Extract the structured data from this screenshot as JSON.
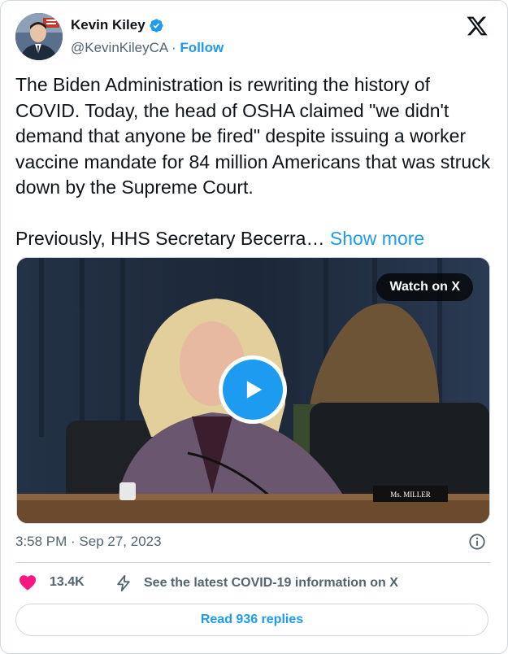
{
  "author": {
    "name": "Kevin Kiley",
    "handle": "@KevinKileyCA",
    "separator": " · ",
    "follow_label": "Follow",
    "verified_icon": "verified-badge-icon"
  },
  "tweet": {
    "text": "The Biden Administration is rewriting the history of COVID. Today, the head of OSHA claimed \"we didn't demand that anyone be fired\" despite issuing a worker vaccine mandate for 84 million Americans that was struck down by the Supreme Court.\n\nPreviously, HHS Secretary Becerra… ",
    "show_more_label": "Show more"
  },
  "media": {
    "watch_label": "Watch on X",
    "nameplate": "Ms. MILLER"
  },
  "meta": {
    "timestamp": "3:58 PM · Sep 27, 2023"
  },
  "actions": {
    "like_count": "13.4K",
    "covid_info": "See the latest COVID-19 information on X"
  },
  "replies": {
    "label": "Read 936 replies"
  },
  "colors": {
    "accent": "#1d9bf0",
    "like": "#f91880",
    "secondary_text": "#536471",
    "border": "#cfd9de"
  }
}
